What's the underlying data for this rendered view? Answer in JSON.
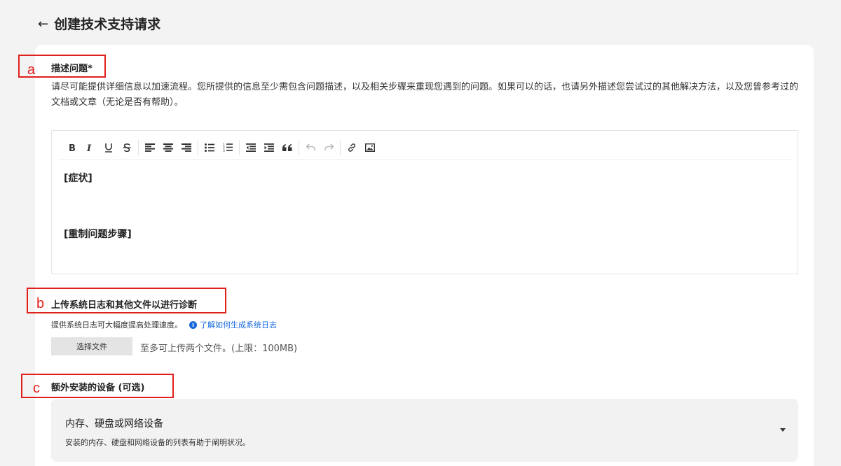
{
  "header": {
    "back_icon": "←",
    "title": "创建技术支持请求"
  },
  "annotations": [
    "a",
    "b",
    "c"
  ],
  "section_a": {
    "title": "描述问题*",
    "description": "请尽可能提供详细信息以加速流程。您所提供的信息至少需包含问题描述，以及相关步骤来重现您遇到的问题。如果可以的话，也请另外描述您尝试过的其他解决方法，以及您曾参考过的文档或文章（无论是否有帮助）。",
    "editor": {
      "toolbar": [
        "bold-icon",
        "italic-icon",
        "underline-icon",
        "strikethrough-icon",
        "align-left-icon",
        "align-center-icon",
        "align-right-icon",
        "bulleted-list-icon",
        "numbered-list-icon",
        "outdent-icon",
        "indent-icon",
        "blockquote-icon",
        "undo-icon",
        "redo-icon",
        "link-icon",
        "image-icon"
      ],
      "lines": [
        "[症状]",
        "[重制问题步骤]"
      ]
    }
  },
  "section_b": {
    "title": "上传系统日志和其他文件以进行诊断",
    "hint": "提供系统日志可大幅度提高处理速度。",
    "info_icon": "i",
    "link": "了解如何生成系统日志",
    "file_button": "选择文件",
    "limit": "至多可上传两个文件。(上限：100MB)"
  },
  "section_c": {
    "title": "额外安装的设备 (可选)",
    "select_label": "内存、硬盘或网络设备",
    "select_sub": "安装的内存、硬盘和网络设备的列表有助于阐明状况。"
  },
  "colors": {
    "annotation": "#e0201c",
    "link": "#1668dc",
    "background": "#f3f3f3"
  }
}
